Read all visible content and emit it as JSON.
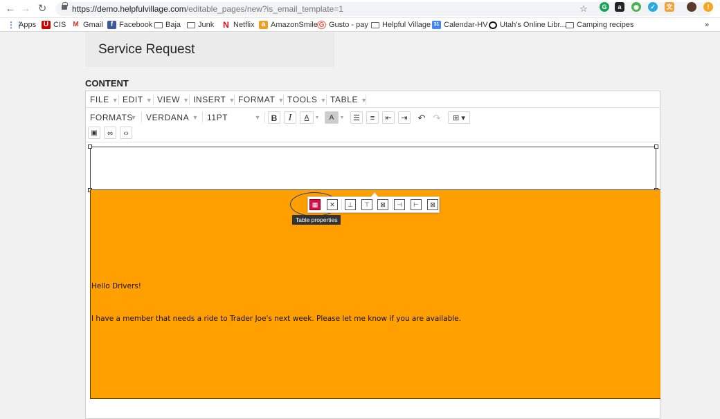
{
  "browser": {
    "url_host": "https://demo.helpfulvillage.com",
    "url_path": "/editable_pages/new?is_email_template=1",
    "bookmarks": [
      "Apps",
      "CIS",
      "Gmail",
      "Facebook",
      "Baja",
      "Junk",
      "Netflix",
      "AmazonSmile",
      "Gusto - pay",
      "Helpful Village",
      "Calendar-HV",
      "Utah's Online Libr...",
      "Camping recipes"
    ],
    "overflow": "»"
  },
  "page": {
    "title": "Service Request",
    "content_label": "CONTENT"
  },
  "editor": {
    "menu": [
      "FILE",
      "EDIT",
      "VIEW",
      "INSERT",
      "FORMAT",
      "TOOLS",
      "TABLE"
    ],
    "formats_label": "FORMATS",
    "font_family": "VERDANA",
    "font_size": "11PT",
    "body_lines": [
      "Hello Drivers!",
      "I have a member that needs a ride to Trader Joe's next week. Please let me know if you are available."
    ],
    "tooltip": "Table properties",
    "table_color": "#ff9f00",
    "highlight_color": "#d4104a"
  }
}
